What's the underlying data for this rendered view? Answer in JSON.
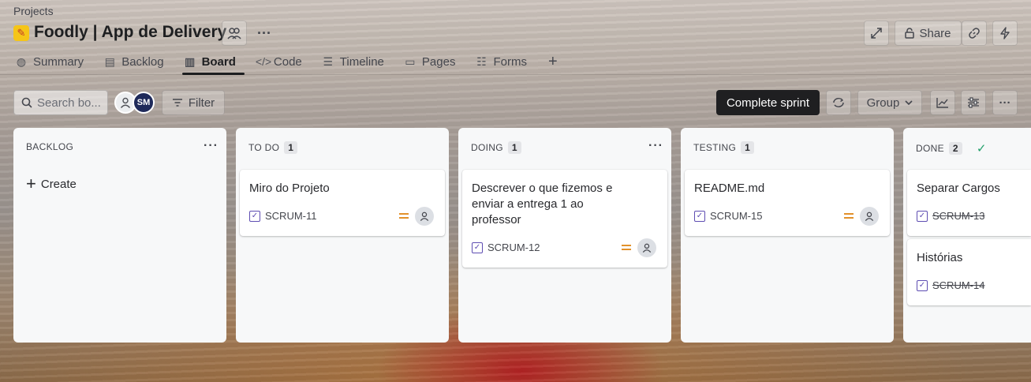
{
  "header": {
    "breadcrumb": "Projects",
    "project_name": "Foodly | App de Delivery",
    "share_label": "Share"
  },
  "tabs": [
    {
      "label": "Summary",
      "icon": "globe-icon"
    },
    {
      "label": "Backlog",
      "icon": "backlog-icon"
    },
    {
      "label": "Board",
      "icon": "board-icon",
      "active": true
    },
    {
      "label": "Code",
      "icon": "code-icon"
    },
    {
      "label": "Timeline",
      "icon": "timeline-icon"
    },
    {
      "label": "Pages",
      "icon": "pages-icon"
    },
    {
      "label": "Forms",
      "icon": "forms-icon"
    }
  ],
  "toolbar": {
    "search_placeholder": "Search bo...",
    "avatar_initials": "SM",
    "filter_label": "Filter",
    "complete_sprint_label": "Complete sprint",
    "group_label": "Group"
  },
  "columns": [
    {
      "title": "BACKLOG",
      "create_label": "Create"
    },
    {
      "title": "TO DO",
      "count": "1",
      "cards": [
        {
          "title": "Miro do Projeto",
          "key": "SCRUM-11"
        }
      ]
    },
    {
      "title": "DOING",
      "count": "1",
      "cards": [
        {
          "title": "Descrever o que fizemos e enviar a entrega 1 ao professor",
          "key": "SCRUM-12"
        }
      ]
    },
    {
      "title": "TESTING",
      "count": "1",
      "cards": [
        {
          "title": "README.md",
          "key": "SCRUM-15"
        }
      ]
    },
    {
      "title": "DONE",
      "count": "2",
      "cards": [
        {
          "title": "Separar Cargos",
          "key": "SCRUM-13"
        },
        {
          "title": "Histórias",
          "key": "SCRUM-14"
        }
      ]
    }
  ],
  "colors": {
    "priority": "#e2912b",
    "done_check": "#22a06b",
    "complete_btn": "#1f1f21"
  }
}
